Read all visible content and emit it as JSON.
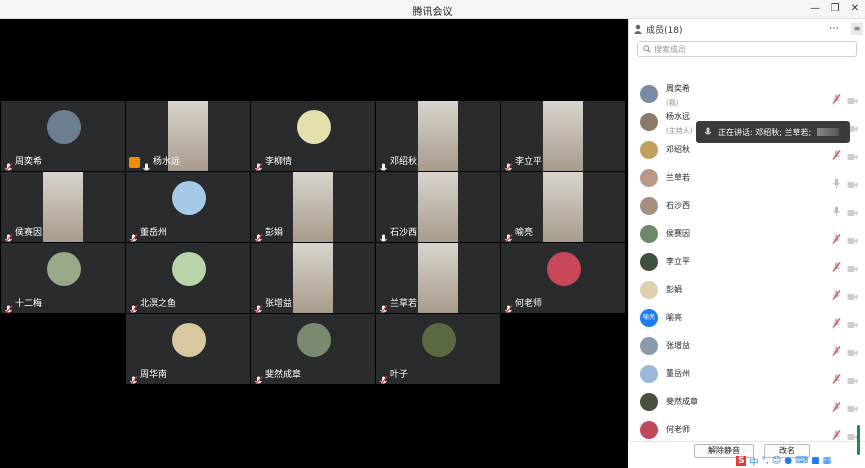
{
  "window": {
    "title": "腾讯会议"
  },
  "colors": {
    "tile_bg": "#2a2b2d",
    "panel_bg": "#ffffff",
    "host_badge": "#f08c00",
    "accent": "#1e7cf2",
    "muted_red": "#e03b3b"
  },
  "tiles": [
    {
      "name": "周奕希",
      "mic": "muted",
      "avatar_color": "#6d7f8e"
    },
    {
      "name": "杨水远",
      "mic": "on",
      "host": true,
      "video": true
    },
    {
      "name": "李柳情",
      "mic": "muted",
      "avatar_color": "#e3e0b0"
    },
    {
      "name": "邓绍秋",
      "mic": "on",
      "video": true
    },
    {
      "name": "李立平",
      "mic": "muted",
      "video": true
    },
    {
      "name": "侯赛因",
      "mic": "muted",
      "video": true
    },
    {
      "name": "董岳州",
      "mic": "muted",
      "avatar_color": "#a8c8e8"
    },
    {
      "name": "彭娟",
      "mic": "muted",
      "video": true
    },
    {
      "name": "石沙西",
      "mic": "on",
      "video": true
    },
    {
      "name": "喻亮",
      "mic": "muted",
      "video": true
    },
    {
      "name": "十二梅",
      "mic": "muted",
      "avatar_color": "#9aa88a"
    },
    {
      "name": "北溟之鱼",
      "mic": "muted",
      "avatar_color": "#b8d4a8"
    },
    {
      "name": "张增益",
      "mic": "muted",
      "video": true
    },
    {
      "name": "兰草若",
      "mic": "muted",
      "video": true
    },
    {
      "name": "何老师",
      "mic": "muted",
      "avatar_color": "#c8485a"
    },
    {
      "name": "周华南",
      "mic": "muted",
      "avatar_color": "#d8c8a0"
    },
    {
      "name": "斐然成章",
      "mic": "muted",
      "avatar_color": "#7a8a70"
    },
    {
      "name": "叶子",
      "mic": "muted",
      "avatar_color": "#5a6a40"
    }
  ],
  "panel": {
    "title": "成员(18)",
    "search_placeholder": "搜索成员",
    "members": [
      {
        "name": "周奕希",
        "sub": "(我)",
        "mic": "muted",
        "avatar_color": "#7a8aa0"
      },
      {
        "name": "杨水远",
        "sub": "(主持人)",
        "mic": "on",
        "avatar_color": "#8a7a6a"
      },
      {
        "name": "邓绍秋",
        "sub": "",
        "mic": "muted",
        "avatar_color": "#c0a060"
      },
      {
        "name": "兰草若",
        "sub": "",
        "mic": "on",
        "avatar_color": "#b89888"
      },
      {
        "name": "石沙西",
        "sub": "",
        "mic": "on",
        "avatar_color": "#a89080"
      },
      {
        "name": "侯赛因",
        "sub": "",
        "mic": "muted",
        "avatar_color": "#6a8a6a"
      },
      {
        "name": "李立平",
        "sub": "",
        "mic": "muted",
        "avatar_color": "#405040"
      },
      {
        "name": "彭娟",
        "sub": "",
        "mic": "muted",
        "avatar_color": "#e0d0b0"
      },
      {
        "name": "喻亮",
        "sub": "",
        "mic": "muted",
        "avatar_color": "#1e7cf2",
        "avatar_text": "喻亮"
      },
      {
        "name": "张增益",
        "sub": "",
        "mic": "muted",
        "avatar_color": "#8a9aa8"
      },
      {
        "name": "董岳州",
        "sub": "",
        "mic": "muted",
        "avatar_color": "#9ab8d8"
      },
      {
        "name": "斐然成章",
        "sub": "",
        "mic": "muted",
        "avatar_color": "#4a5040"
      },
      {
        "name": "何老师",
        "sub": "",
        "mic": "muted",
        "avatar_color": "#c04858"
      }
    ],
    "speaking_tooltip": "正在讲话: 邓绍秋; 兰草若;",
    "unmute_all": "解除静音",
    "rename": "改名"
  },
  "ime": {
    "label": "中"
  }
}
